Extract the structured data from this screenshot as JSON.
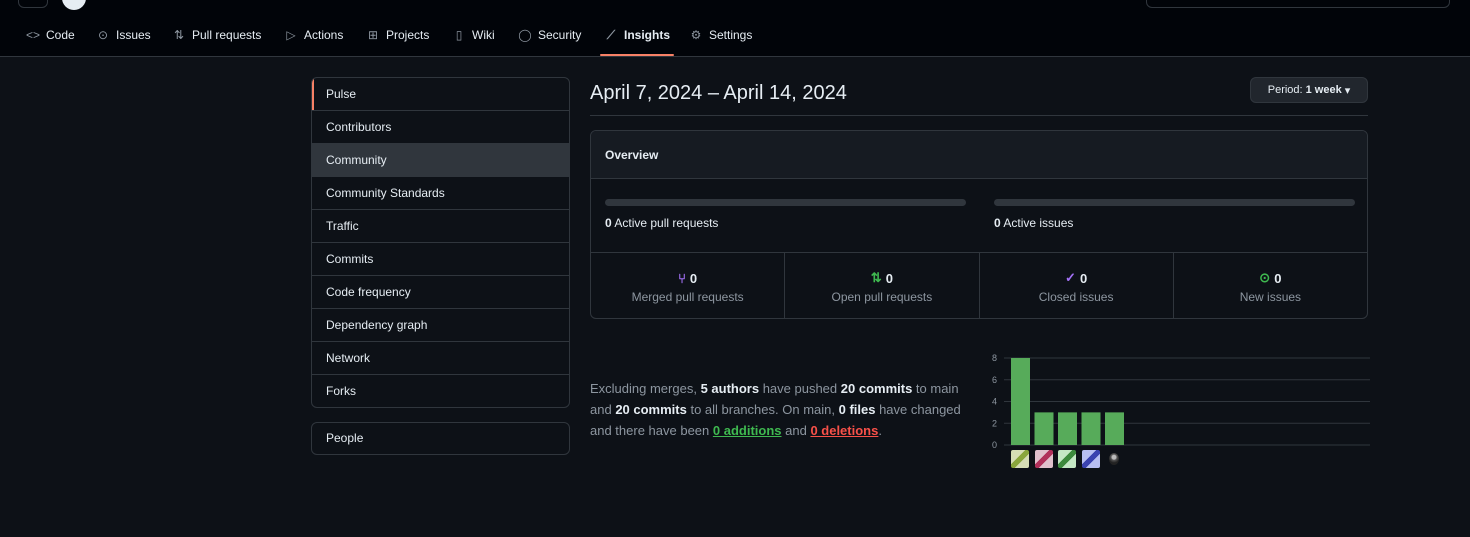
{
  "nav": {
    "items": [
      {
        "label": "Code",
        "icon": "code-icon"
      },
      {
        "label": "Issues",
        "icon": "issue-icon"
      },
      {
        "label": "Pull requests",
        "icon": "pull-request-icon"
      },
      {
        "label": "Actions",
        "icon": "play-icon"
      },
      {
        "label": "Projects",
        "icon": "table-icon"
      },
      {
        "label": "Wiki",
        "icon": "book-icon"
      },
      {
        "label": "Security",
        "icon": "shield-icon"
      },
      {
        "label": "Insights",
        "icon": "graph-icon"
      },
      {
        "label": "Settings",
        "icon": "gear-icon"
      }
    ],
    "active": "Insights"
  },
  "sidebar": {
    "items": [
      "Pulse",
      "Contributors",
      "Community",
      "Community Standards",
      "Traffic",
      "Commits",
      "Code frequency",
      "Dependency graph",
      "Network",
      "Forks"
    ],
    "selected": "Pulse",
    "hovered": "Community",
    "secondary": [
      "People"
    ]
  },
  "main": {
    "date_range": "April 7, 2024 – April 14, 2024",
    "period_prefix": "Period:",
    "period_value": "1 week",
    "overview": {
      "title": "Overview",
      "active_prs_count": "0",
      "active_prs_label": "Active pull requests",
      "active_issues_count": "0",
      "active_issues_label": "Active issues",
      "stats": [
        {
          "count": "0",
          "label": "Merged pull requests",
          "icon": "git-merge-icon"
        },
        {
          "count": "0",
          "label": "Open pull requests",
          "icon": "git-pull-request-icon"
        },
        {
          "count": "0",
          "label": "Closed issues",
          "icon": "issue-closed-icon"
        },
        {
          "count": "0",
          "label": "New issues",
          "icon": "issue-opened-icon"
        }
      ]
    },
    "summary": {
      "t1": "Excluding merges, ",
      "authors": "5 authors",
      "t2": " have pushed ",
      "commits_main": "20 commits",
      "t3": " to main and ",
      "commits_all": "20 commits",
      "t4": " to all branches. On main, ",
      "files": "0 files",
      "t5": " have changed and there have been ",
      "additions": "0 additions",
      "t6": " and ",
      "deletions": "0 deletions",
      "t7": "."
    }
  },
  "colors": {
    "accent": "#f78166",
    "bar": "#57ab5a",
    "green": "#3fb950",
    "red": "#f85149",
    "purple": "#a371f7"
  },
  "chart_data": {
    "type": "bar",
    "categories": [
      "author-1",
      "author-2",
      "author-3",
      "author-4",
      "author-5"
    ],
    "values": [
      8,
      3,
      3,
      3,
      3
    ],
    "yticks": [
      0,
      2,
      4,
      6,
      8
    ],
    "ylim": [
      0,
      8
    ],
    "title": "",
    "xlabel": "",
    "ylabel": "",
    "grid": true
  }
}
